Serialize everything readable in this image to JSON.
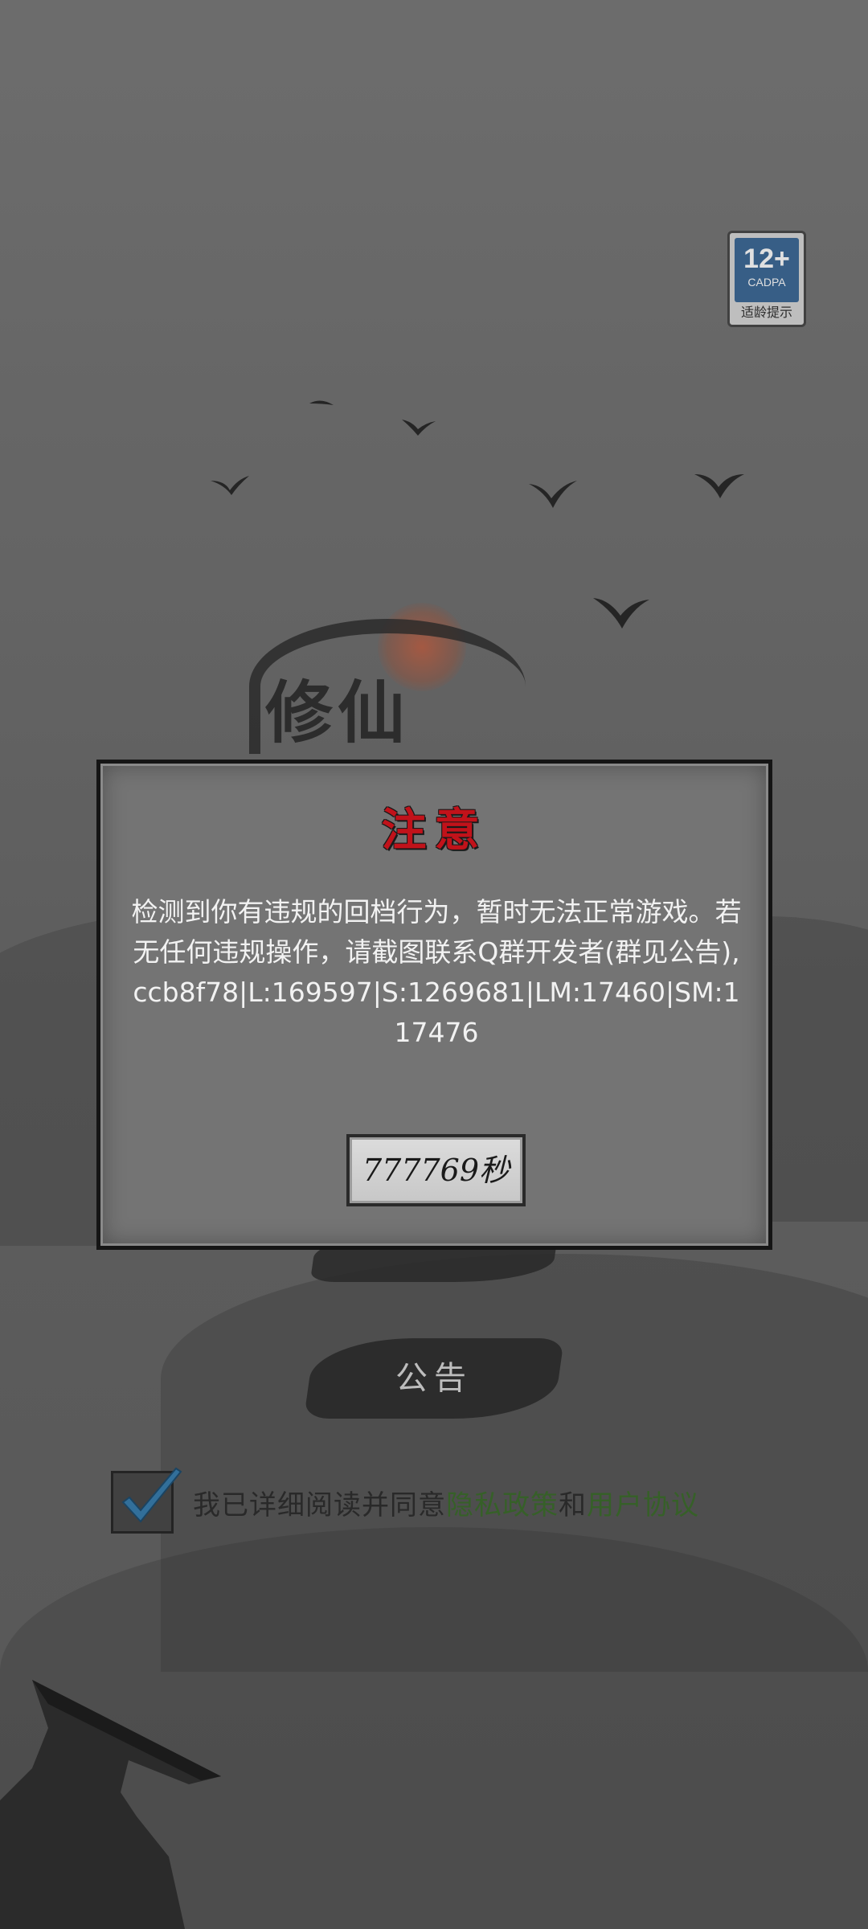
{
  "age_badge": {
    "rating": "12+",
    "org": "CADPA",
    "caption": "适龄提示"
  },
  "logo": {
    "title": "修仙"
  },
  "dialog": {
    "title": "注意",
    "message": "检测到你有违规的回档行为，暂时无法正常游戏。若无任何违规操作，请截图联系Q群开发者(群见公告),ccb8f78|L:169597|S:1269681|LM:17460|SM:117476",
    "countdown": "777769秒"
  },
  "menu": {
    "notice_label": "公告"
  },
  "agreement": {
    "prefix": "我已详细阅读并同意",
    "privacy_link": "隐私政策",
    "and": "和",
    "user_link": "用户协议",
    "checked": true
  },
  "colors": {
    "title_red": "#c1121a",
    "link_green": "#3e6e2e",
    "badge_blue": "#3f6b99"
  }
}
